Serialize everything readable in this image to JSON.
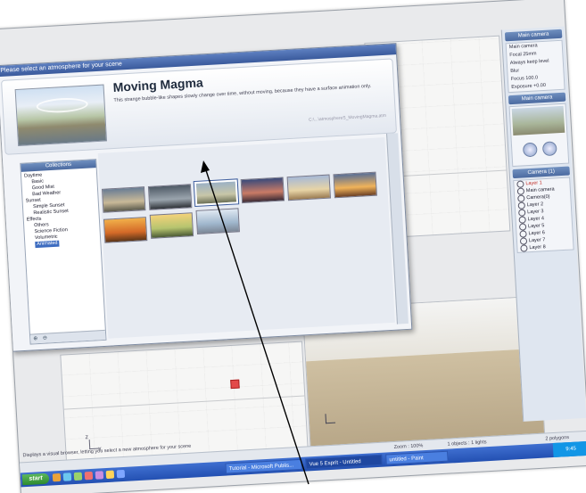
{
  "dialog": {
    "window_title": "Please select an atmosphere for your scene",
    "selected_name": "Moving Magma",
    "selected_description": "This strange bubble-like shapes slowly change over time, without moving, because they have a surface animation only.",
    "file_label": "C:\\...\\atmosphereS_MovingMagma.atm",
    "collections_header": "Collections",
    "collections": [
      {
        "label": "Daytime",
        "sel": false
      },
      {
        "label": "Basic",
        "sel": false
      },
      {
        "label": "Good Mist",
        "sel": false
      },
      {
        "label": "Bad Weather",
        "sel": false
      },
      {
        "label": "Sunset",
        "sel": false
      },
      {
        "label": "Simple Sunset",
        "sel": false
      },
      {
        "label": "Realistic Sunset",
        "sel": false
      },
      {
        "label": "Effects",
        "sel": false
      },
      {
        "label": "Others",
        "sel": false
      },
      {
        "label": "Science Fiction",
        "sel": false
      },
      {
        "label": "Volumetric",
        "sel": false
      },
      {
        "label": "Animated",
        "sel": true
      }
    ],
    "thumbnails": [
      {
        "colors": [
          "#6a7d94",
          "#c9b998",
          "#5b5a4d"
        ]
      },
      {
        "colors": [
          "#4f5a66",
          "#9aa4ad",
          "#2f3338"
        ]
      },
      {
        "colors": [
          "#9cb1c4",
          "#c8c6a8",
          "#6b6f55"
        ],
        "selected": true
      },
      {
        "colors": [
          "#3c4b7a",
          "#c97b66",
          "#3a2a35"
        ]
      },
      {
        "colors": [
          "#a7b9d6",
          "#e7d4a6",
          "#9a7b52"
        ]
      },
      {
        "colors": [
          "#5a6f95",
          "#f0b35a",
          "#6b4025"
        ]
      },
      {
        "colors": [
          "#f1b04a",
          "#d46a28",
          "#5a3518"
        ]
      },
      {
        "colors": [
          "#f3d27a",
          "#b6c46f",
          "#4b5a35"
        ]
      },
      {
        "colors": [
          "#dfe8f2",
          "#9fb6cc",
          "#7c8796"
        ]
      }
    ]
  },
  "right_panel": {
    "header_main_camera": "Main camera",
    "camera_fields": [
      "Main camera",
      "Focal  25mm",
      "Always keep level",
      "Blur",
      "Focus  100.0",
      "Exposure  +0.00"
    ],
    "preview_header": "Main camera",
    "camera_list_header": "Camera (1)",
    "cameras": [
      "Main camera",
      "Camera(0)"
    ],
    "layers_header": "Layer 1",
    "layers": [
      "Layer 2",
      "Layer 3",
      "Layer 4",
      "Layer 5",
      "Layer 6",
      "Layer 7",
      "Layer 8"
    ]
  },
  "viewports": {
    "axis_x": "x",
    "axis_z": "z",
    "percent_label": "100%"
  },
  "statusbar": {
    "zoom": "Zoom : 100%",
    "objects": "1 objects : 1 lights",
    "polygons": "2 polygons"
  },
  "hint": "Displays a visual browser, letting you select a new atmosphere for your scene",
  "taskbar": {
    "start_label": "start",
    "tasks": [
      {
        "label": "Tutorial - Microsoft Publis...",
        "active": false
      },
      {
        "label": "Vue 5 Esprit - Untitled",
        "active": true
      },
      {
        "label": "untitled - Paint",
        "active": false
      }
    ],
    "clock": "9:45"
  },
  "colors": {
    "titlebar": "#3a5a9c",
    "taskbar": "#2350b2",
    "start": "#2e8b2e",
    "selection": "#3d6cc0"
  }
}
